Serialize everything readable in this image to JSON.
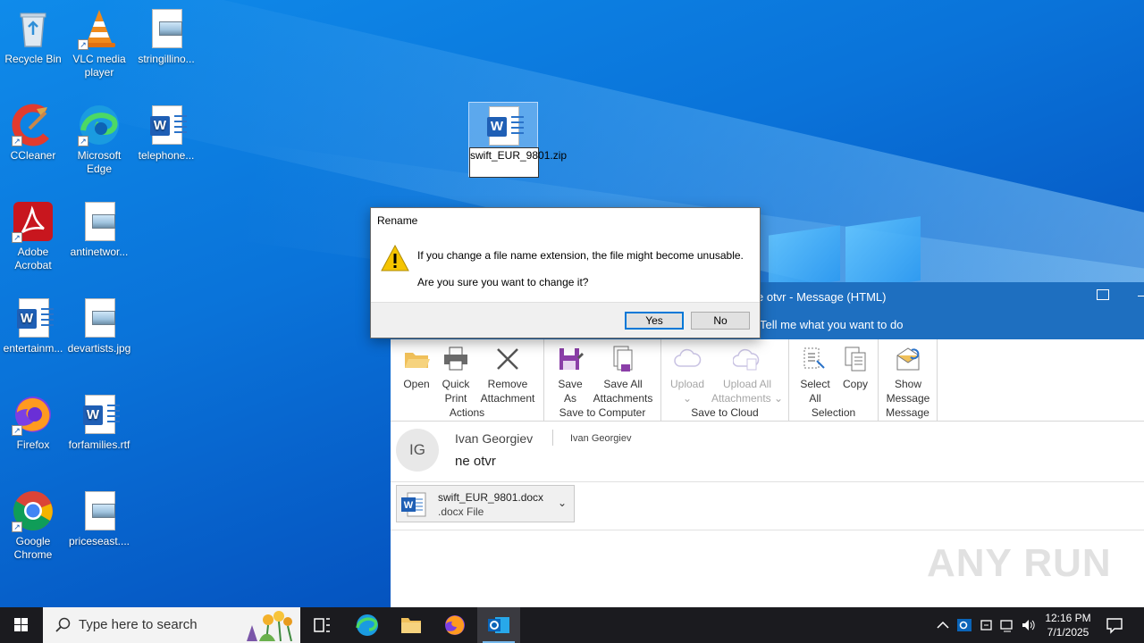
{
  "desktop": {
    "icons": [
      {
        "label": "Recycle Bin"
      },
      {
        "label": "VLC media player"
      },
      {
        "label": "stringillino..."
      },
      {
        "label": "CCleaner"
      },
      {
        "label": "Microsoft Edge"
      },
      {
        "label": "telephone..."
      },
      {
        "label": "Adobe Acrobat"
      },
      {
        "label": "antinetwor..."
      },
      {
        "label": "entertainm..."
      },
      {
        "label": "devartists.jpg"
      },
      {
        "label": "Firefox"
      },
      {
        "label": "forfamilies.rtf"
      },
      {
        "label": "Google Chrome"
      },
      {
        "label": "priceseast...."
      }
    ],
    "selected_file": {
      "rename_value": "swift_EUR_9801.zip"
    }
  },
  "dialog": {
    "title": "Rename",
    "message": "If you change a file name extension, the file might become unusable.",
    "question": "Are you sure you want to change it?",
    "yes_label": "Yes",
    "no_label": "No"
  },
  "outlook": {
    "title": "e otvr  -  Message (HTML)",
    "tell_me": "Tell me what you want to do",
    "ribbon": {
      "groups": [
        {
          "name": "Actions",
          "buttons": [
            "Open",
            "Quick Print",
            "Remove Attachment"
          ]
        },
        {
          "name": "Save to Computer",
          "buttons": [
            "Save As",
            "Save All Attachments"
          ]
        },
        {
          "name": "Save to Cloud",
          "buttons": [
            "Upload",
            "Upload All Attachments"
          ]
        },
        {
          "name": "Selection",
          "buttons": [
            "Select All",
            "Copy"
          ]
        },
        {
          "name": "Message",
          "buttons": [
            "Show Message"
          ]
        }
      ]
    },
    "header": {
      "avatar_initials": "IG",
      "sender": "Ivan Georgiev",
      "to": "Ivan Georgiev",
      "subject": "ne otvr"
    },
    "attachment": {
      "name": "swift_EUR_9801.docx",
      "type": ".docx File"
    },
    "watermark": "ANY RUN"
  },
  "taskbar": {
    "search_placeholder": "Type here to search",
    "time": "12:16 PM",
    "date": "7/1/2025"
  },
  "colors": {
    "taskbar_bg": "#1b1b1f",
    "outlook_blue": "#1e6fc0",
    "dialog_default_border": "#0078d7"
  }
}
